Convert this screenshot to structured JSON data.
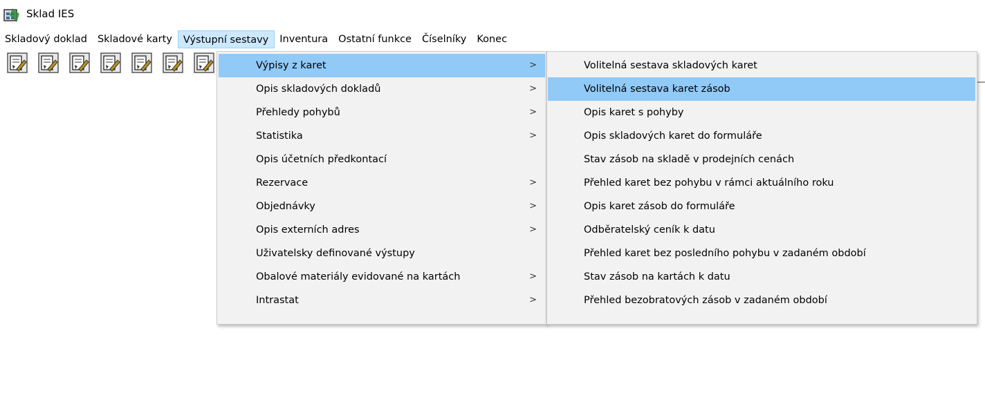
{
  "window": {
    "title": "Sklad IES",
    "icon": "warehouse-app-icon"
  },
  "menubar": [
    {
      "label": "Skladový doklad",
      "active": false
    },
    {
      "label": "Skladové karty",
      "active": false
    },
    {
      "label": "Výstupní sestavy",
      "active": true
    },
    {
      "label": "Inventura",
      "active": false
    },
    {
      "label": "Ostatní funkce",
      "active": false
    },
    {
      "label": "Číselníky",
      "active": false
    },
    {
      "label": "Konec",
      "active": false
    }
  ],
  "toolbar": {
    "button_count": 7,
    "icon": "document-edit-icon"
  },
  "submenu_main": [
    {
      "label": "Výpisy z karet",
      "has_submenu": true,
      "highlighted": true
    },
    {
      "label": "Opis skladových dokladů",
      "has_submenu": true
    },
    {
      "label": "Přehledy pohybů",
      "has_submenu": true
    },
    {
      "label": "Statistika",
      "has_submenu": true
    },
    {
      "label": "Opis účetních předkontací",
      "has_submenu": false
    },
    {
      "label": "Rezervace",
      "has_submenu": true
    },
    {
      "label": "Objednávky",
      "has_submenu": true
    },
    {
      "label": "Opis externích adres",
      "has_submenu": true
    },
    {
      "label": "Uživatelsky definované výstupy",
      "has_submenu": false
    },
    {
      "label": "Obalové materiály evidované na kartách",
      "has_submenu": true
    },
    {
      "label": "Intrastat",
      "has_submenu": true
    }
  ],
  "submenu_cards": [
    {
      "label": "Volitelná sestava skladových karet"
    },
    {
      "label": "Volitelná sestava karet zásob",
      "highlighted": true
    },
    {
      "label": "Opis karet s pohyby"
    },
    {
      "label": "Opis skladových karet do formuláře"
    },
    {
      "label": "Stav zásob na skladě v prodejních cenách"
    },
    {
      "label": "Přehled karet bez pohybu v rámci aktuálního roku"
    },
    {
      "label": "Opis karet zásob do formuláře"
    },
    {
      "label": "Odběratelský ceník k datu"
    },
    {
      "label": "Přehled karet bez posledního pohybu v zadaném období"
    },
    {
      "label": "Stav zásob na kartách k datu"
    },
    {
      "label": "Přehled bezobratových zásob v zadaném období"
    }
  ],
  "arrow_glyph": ">",
  "colors": {
    "highlight": "#91c9f7",
    "menu_active": "#cce8ff",
    "menu_bg": "#f2f2f2"
  }
}
